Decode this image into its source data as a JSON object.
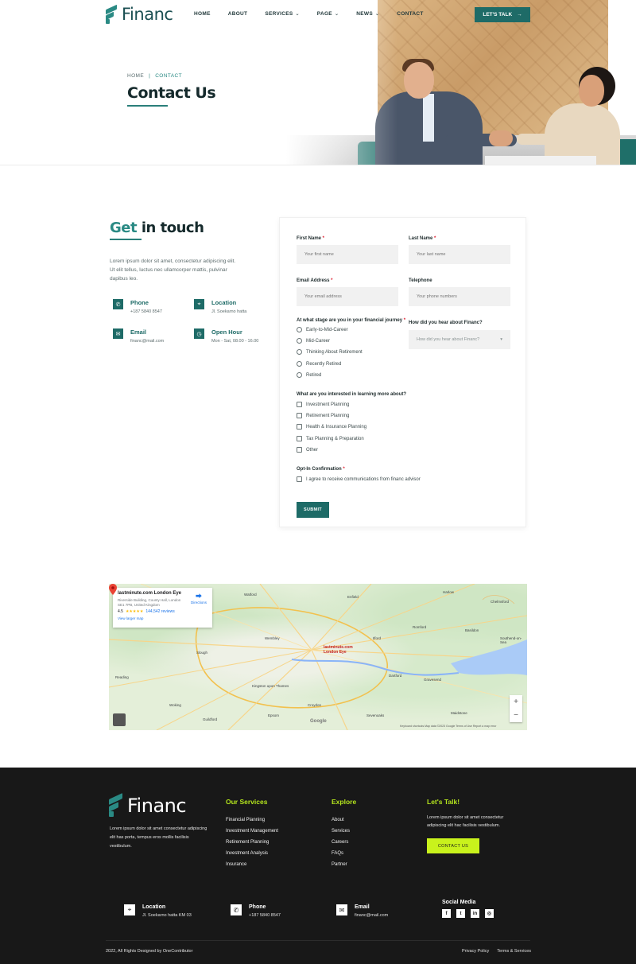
{
  "brand": {
    "name": "Financ",
    "accent": "#1e6b67",
    "lime": "#c9f21c"
  },
  "nav": {
    "items": [
      {
        "label": "HOME",
        "dropdown": false
      },
      {
        "label": "ABOUT",
        "dropdown": false
      },
      {
        "label": "SERVICES",
        "dropdown": true
      },
      {
        "label": "PAGE",
        "dropdown": true
      },
      {
        "label": "NEWS",
        "dropdown": true
      },
      {
        "label": "CONTACT",
        "dropdown": false
      }
    ],
    "cta": "LET'S TALK"
  },
  "hero": {
    "breadcrumb": [
      "HOME",
      "CONTACT"
    ],
    "title": "Contact Us"
  },
  "touch": {
    "title_accent": "Get",
    "title_rest": "in touch",
    "description": "Lorem ipsum dolor sit amet, consectetur adipiscing elit. Ut elit tellus, luctus nec ullamcorper mattis, pulvinar dapibus leo.",
    "info": [
      {
        "title": "Phone",
        "value": "+187 5840 8547",
        "icon": "phone-icon"
      },
      {
        "title": "Location",
        "value": "Jl. Soekarno hatta",
        "icon": "location-icon"
      },
      {
        "title": "Email",
        "value": "financ@mail.com",
        "icon": "email-icon"
      },
      {
        "title": "Open Hour",
        "value": "Mon - Sat, 08.00 - 16.00",
        "icon": "clock-icon"
      }
    ]
  },
  "form": {
    "first_name": {
      "label": "First Name",
      "placeholder": "Your first name"
    },
    "last_name": {
      "label": "Last Name",
      "placeholder": "Your last name"
    },
    "email": {
      "label": "Email Address",
      "placeholder": "Your email address"
    },
    "telephone": {
      "label": "Telephone",
      "placeholder": "Your phone numbers"
    },
    "stage": {
      "label": "At what stage are you in your financial journey",
      "options": [
        "Early-to-Mid-Career",
        "Mid-Career",
        "Thinking About Retirement",
        "Recently Retired",
        "Retired"
      ]
    },
    "hear": {
      "label": "How did you hear about Financ?",
      "placeholder": "How did you hear about Financ?"
    },
    "interests": {
      "label": "What are you interested in learning more about?",
      "options": [
        "Investment Planning",
        "Retirement Planning",
        "Health & Insurance Planning",
        "Tax Planning & Preparation",
        "Other"
      ]
    },
    "optin": {
      "label": "Opt-In Confirmation",
      "text": "I agree to receive communications from financ advisor"
    },
    "submit": "SUBMIT"
  },
  "map": {
    "place": "lastminute.com London Eye",
    "address": "Riverside Building, County Hall, London SE1 7PB, United Kingdom",
    "rating": "4.5",
    "stars": "★★★★★",
    "reviews": "144,542 reviews",
    "larger_map": "View larger map",
    "directions": "Directions",
    "pin_label": "lastminute.com London Eye",
    "zoom_in": "+",
    "zoom_out": "−",
    "google": "Google",
    "attribution": "Keyboard shortcuts   Map data ©2023 Google   Terms of Use   Report a map error",
    "towns": [
      "Watford",
      "Enfield",
      "Harlow",
      "Slough",
      "Wembley",
      "Ilford",
      "Romford",
      "Basildon",
      "Southend-on-Sea",
      "Croydon",
      "Epsom",
      "Dartford",
      "Gravesend",
      "Sevenoaks",
      "Kingston upon Thames",
      "Reading",
      "Woking",
      "Guildford",
      "Maidstone",
      "Chelmsford"
    ]
  },
  "footer": {
    "description": "Lorem ipsum dolor sit amet consectetur adipiscing elit has porta, tempus eros mollis facilisis vestibulum.",
    "services": {
      "title": "Our Services",
      "links": [
        "Financial Planning",
        "Investment Management",
        "Retirement Planning",
        "Investment Analysis",
        "Insurance"
      ]
    },
    "explore": {
      "title": "Explore",
      "links": [
        "About",
        "Services",
        "Careers",
        "FAQs",
        "Partner"
      ]
    },
    "talk": {
      "title": "Let's Talk!",
      "text": "Lorem ipsum dolor sit amet consectetur adipiscing elit hac facilisis vestibulum.",
      "button": "CONTACT US"
    },
    "contacts": [
      {
        "title": "Location",
        "value": "Jl. Soekarno hatta KM 03",
        "icon": "location-icon"
      },
      {
        "title": "Phone",
        "value": "+187 5840 8547",
        "icon": "phone-icon"
      },
      {
        "title": "Email",
        "value": "financ@mail.com",
        "icon": "email-icon"
      }
    ],
    "social_title": "Social Media",
    "socials": [
      {
        "glyph": "f",
        "icon": "facebook-icon"
      },
      {
        "glyph": "t",
        "icon": "twitter-icon"
      },
      {
        "glyph": "in",
        "icon": "linkedin-icon"
      },
      {
        "glyph": "◎",
        "icon": "instagram-icon"
      }
    ],
    "copyright": "2022, All Rights Designed by OneContributor",
    "legal": [
      "Privacy Policy",
      "Terms & Services"
    ]
  }
}
